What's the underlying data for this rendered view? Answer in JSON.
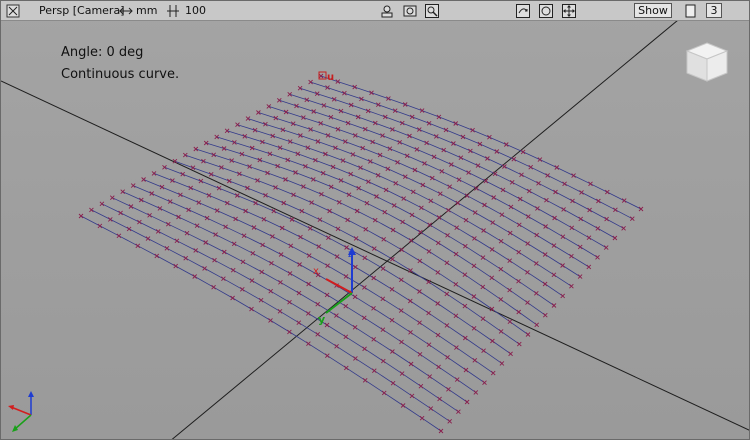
{
  "toolbar": {
    "view_label": "Persp [Camera]",
    "unit_label": "mm",
    "grid_label": "100",
    "show_label": "Show",
    "viewport_count": "3",
    "icons": {
      "close": "close-icon",
      "unit": "arrow-resize-icon",
      "grid": "grid-spacing-icon",
      "camera": "camera-icon",
      "record": "record-icon",
      "zoom": "magnifier-icon",
      "tumble": "tumble-icon",
      "orbit": "orbit-icon",
      "pan": "pan-icon",
      "layout": "viewport-layout-icon"
    }
  },
  "info": {
    "angle_text": "Angle: 0 deg",
    "curve_text": "Continuous curve."
  },
  "labels": {
    "x": "x",
    "y": "y",
    "z": "z",
    "u": "u"
  },
  "colors": {
    "curve": "#333a8a",
    "marker": "#8a1e4c",
    "axis": "#1e1e1e",
    "x_axis": "#d21e1e",
    "y_axis": "#19a019",
    "z_axis": "#1e3cd2"
  }
}
